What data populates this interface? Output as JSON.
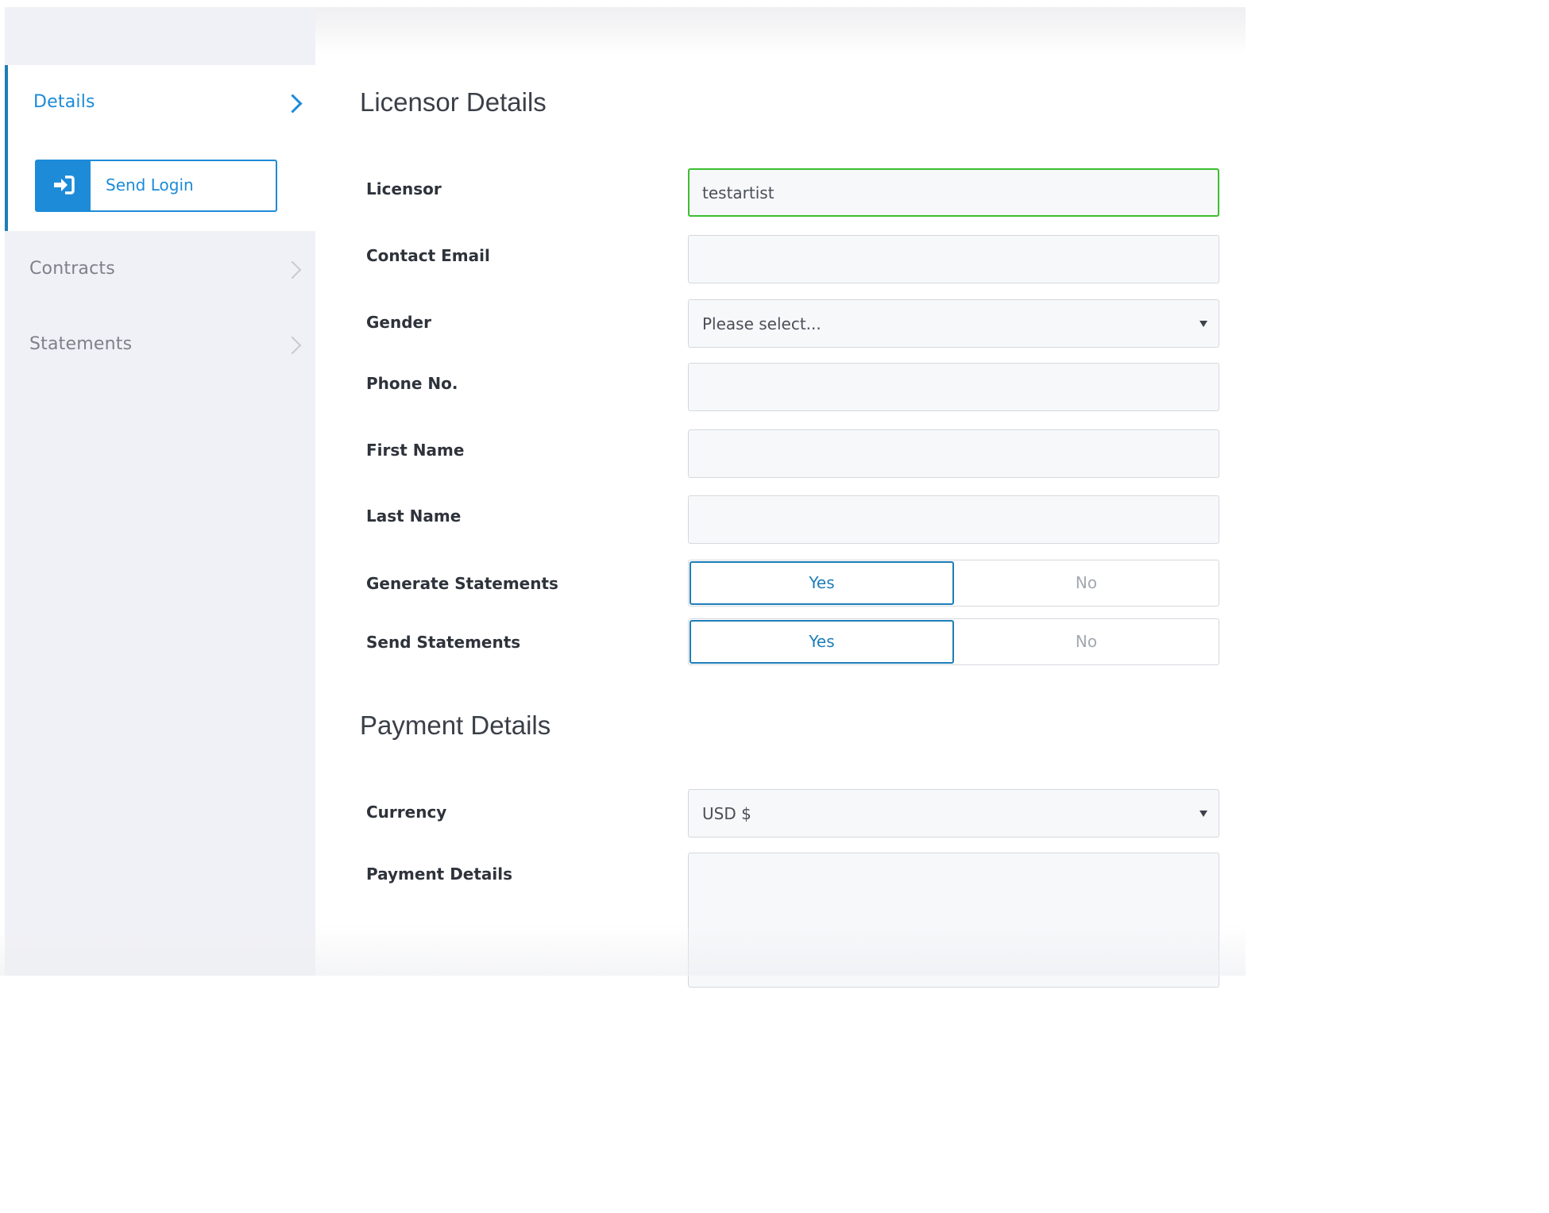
{
  "sidebar": {
    "items": [
      {
        "label": "Details",
        "active": true
      },
      {
        "label": "Contracts",
        "active": false
      },
      {
        "label": "Statements",
        "active": false
      }
    ],
    "send_login": {
      "label": "Send Login",
      "icon": "sign-in-icon"
    },
    "active_color": "#1d8bd8"
  },
  "licensor_section": {
    "title": "Licensor Details",
    "fields": {
      "licensor": {
        "label": "Licensor",
        "value": "testartist"
      },
      "contact_email": {
        "label": "Contact Email",
        "value": ""
      },
      "gender": {
        "label": "Gender",
        "value": "Please select..."
      },
      "phone": {
        "label": "Phone No.",
        "value": ""
      },
      "first_name": {
        "label": "First Name",
        "value": ""
      },
      "last_name": {
        "label": "Last Name",
        "value": ""
      },
      "generate_statements": {
        "label": "Generate Statements",
        "yes": "Yes",
        "no": "No",
        "selected": "Yes"
      },
      "send_statements": {
        "label": "Send Statements",
        "yes": "Yes",
        "no": "No",
        "selected": "Yes"
      }
    }
  },
  "payment_section": {
    "title": "Payment Details",
    "fields": {
      "currency": {
        "label": "Currency",
        "value": "USD $"
      },
      "payment_details": {
        "label": "Payment Details",
        "value": ""
      }
    }
  },
  "colors": {
    "accent": "#1d8bd8",
    "active_input_border": "#3bbf2e",
    "sidebar_bg": "#f0f1f6"
  }
}
